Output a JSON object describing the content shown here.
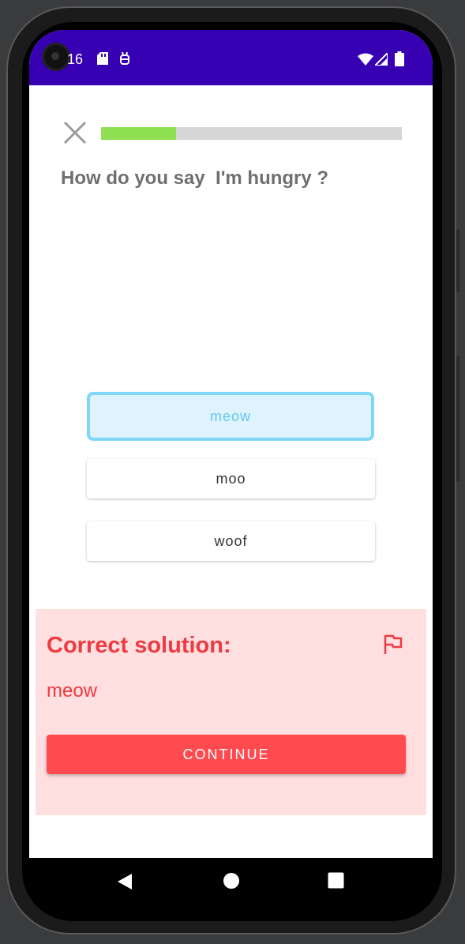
{
  "status_bar": {
    "time": "16",
    "color": "#3700b3",
    "left_icons": [
      "sd-card-icon",
      "android-debug-icon"
    ],
    "right_icons": [
      "wifi-icon",
      "cell-signal-icon",
      "battery-icon"
    ]
  },
  "lesson": {
    "close_icon": "close-icon",
    "progress_fraction": 0.25,
    "prompt": "How do you say  I'm hungry ?"
  },
  "options": [
    {
      "label": "meow",
      "selected": true
    },
    {
      "label": "moo",
      "selected": false
    },
    {
      "label": "woof",
      "selected": false
    }
  ],
  "feedback": {
    "title": "Correct solution:",
    "answer": "meow",
    "flag_icon": "flag-icon",
    "continue_label": "CONTINUE",
    "background": "#ffdfe0",
    "accent": "#ee3a42",
    "button_color": "#ff4a4f"
  },
  "nav": {
    "back_icon": "back-triangle-icon",
    "home_icon": "home-circle-icon",
    "recents_icon": "recents-square-icon"
  }
}
